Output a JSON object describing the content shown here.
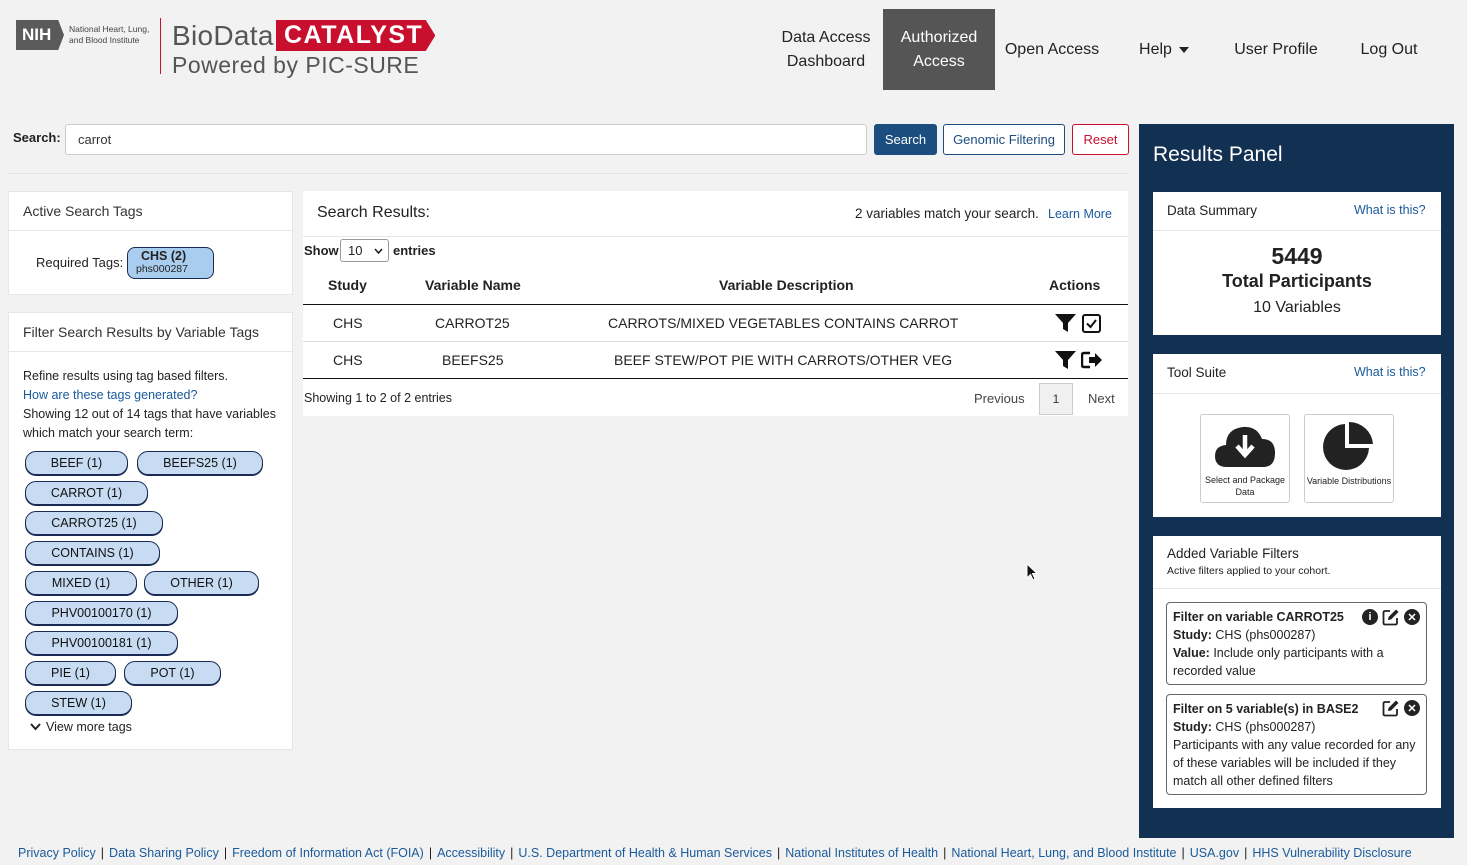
{
  "logo": {
    "nih": "NIH",
    "nih_text": "National Heart, Lung, and Blood Institute",
    "bio": "BioData",
    "catalyst": "CATALYST",
    "powered": "Powered by PIC-SURE"
  },
  "nav": {
    "data_access": "Data Access Dashboard",
    "authorized": "Authorized Access",
    "open": "Open Access",
    "help": "Help",
    "profile": "User Profile",
    "logout": "Log Out"
  },
  "search": {
    "label": "Search:",
    "value": "carrot",
    "search_btn": "Search",
    "genomic_btn": "Genomic Filtering",
    "reset_btn": "Reset"
  },
  "active_tags": {
    "title": "Active Search Tags",
    "required_label": "Required Tags:",
    "tag_name": "CHS (2)",
    "tag_sub": "phs000287"
  },
  "filter_tags": {
    "title": "Filter Search Results by Variable Tags",
    "refine": "Refine results using tag based filters.",
    "how_link": "How are these tags generated?",
    "showing": "Showing 12 out of 14 tags that have variables which match your search term:",
    "tags": [
      "BEEF (1)",
      "BEEFS25 (1)",
      "CARROT (1)",
      "CARROT25 (1)",
      "CONTAINS (1)",
      "MIXED (1)",
      "OTHER (1)",
      "PHV00100170 (1)",
      "PHV00100181 (1)",
      "PIE (1)",
      "POT (1)",
      "STEW (1)"
    ],
    "view_more": "View more tags"
  },
  "results": {
    "title": "Search Results:",
    "match_text": "2 variables match your search.",
    "learn_more": "Learn More",
    "show": "Show",
    "entries_value": "10",
    "entries": "entries",
    "columns": [
      "Study",
      "Variable Name",
      "Variable Description",
      "Actions"
    ],
    "rows": [
      {
        "study": "CHS",
        "name": "CARROT25",
        "desc": "CARROTS/MIXED VEGETABLES CONTAINS CARROT"
      },
      {
        "study": "CHS",
        "name": "BEEFS25",
        "desc": "BEEF STEW/POT PIE WITH CARROTS/OTHER VEG"
      }
    ],
    "showing": "Showing 1 to 2 of 2 entries",
    "previous": "Previous",
    "page": "1",
    "next": "Next"
  },
  "panel": {
    "title": "Results Panel",
    "summary_title": "Data Summary",
    "what": "What is this?",
    "participants": "5449",
    "participants_label": "Total Participants",
    "variables": "10 Variables",
    "tool_title": "Tool Suite",
    "tool1_label": "Select and Package Data",
    "tool2_label": "Variable Distributions",
    "added_title": "Added Variable Filters",
    "added_sub": "Active filters applied to your cohort.",
    "filter1": {
      "title": "Filter on variable CARROT25",
      "study_label": "Study:",
      "study": "CHS (phs000287)",
      "value_label": "Value:",
      "value": "Include only participants with a recorded value"
    },
    "filter2": {
      "title": "Filter on 5 variable(s) in BASE2",
      "study_label": "Study:",
      "study": "CHS (phs000287)",
      "desc": "Participants with any value recorded for any of these variables will be included if they match all other defined filters"
    }
  },
  "footer": [
    "Privacy Policy",
    "Data Sharing Policy",
    "Freedom of Information Act (FOIA)",
    "Accessibility",
    "U.S. Department of Health & Human Services",
    "National Institutes of Health",
    "National Heart, Lung, and Blood Institute",
    "USA.gov",
    "HHS Vulnerability Disclosure"
  ]
}
